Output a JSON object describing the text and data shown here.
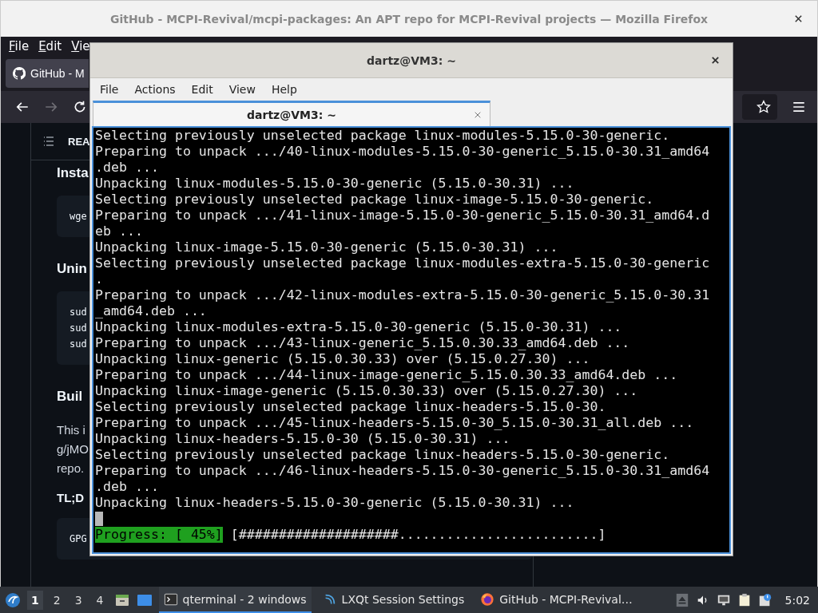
{
  "browser": {
    "title": "GitHub - MCPI-Revival/mcpi-packages: An APT repo for MCPI-Revival projects — Mozilla Firefox",
    "menu": [
      "File",
      "Edit",
      "Vie"
    ],
    "tabs": [
      {
        "label": "GitHub - M",
        "selected": true
      }
    ],
    "readme_label": "REA",
    "content": [
      {
        "kind": "heading",
        "text": "Insta"
      },
      {
        "kind": "code",
        "lines": [
          "wge"
        ]
      },
      {
        "kind": "heading",
        "text": "Unin"
      },
      {
        "kind": "code",
        "lines": [
          "sud",
          "sud",
          "sud"
        ]
      },
      {
        "kind": "heading",
        "text": "Buil"
      },
      {
        "kind": "paragraph",
        "lines": [
          "This i",
          "g/jMO",
          "repo."
        ]
      },
      {
        "kind": "subheading",
        "text": "TL;D"
      },
      {
        "kind": "code",
        "lines": [
          "GPG"
        ]
      }
    ]
  },
  "terminal": {
    "title": "dartz@VM3: ~",
    "menu": [
      "File",
      "Actions",
      "Edit",
      "View",
      "Help"
    ],
    "tabs": [
      {
        "label": "dartz@VM3: ~",
        "selected": true
      }
    ],
    "lines": [
      "Selecting previously unselected package linux-modules-5.15.0-30-generic.",
      "Preparing to unpack .../40-linux-modules-5.15.0-30-generic_5.15.0-30.31_amd64",
      ".deb ...",
      "Unpacking linux-modules-5.15.0-30-generic (5.15.0-30.31) ...",
      "Selecting previously unselected package linux-image-5.15.0-30-generic.",
      "Preparing to unpack .../41-linux-image-5.15.0-30-generic_5.15.0-30.31_amd64.d",
      "eb ...",
      "Unpacking linux-image-5.15.0-30-generic (5.15.0-30.31) ...",
      "Selecting previously unselected package linux-modules-extra-5.15.0-30-generic",
      ".",
      "Preparing to unpack .../42-linux-modules-extra-5.15.0-30-generic_5.15.0-30.31",
      "_amd64.deb ...",
      "Unpacking linux-modules-extra-5.15.0-30-generic (5.15.0-30.31) ...",
      "Preparing to unpack .../43-linux-generic_5.15.0.30.33_amd64.deb ...",
      "Unpacking linux-generic (5.15.0.30.33) over (5.15.0.27.30) ...",
      "Preparing to unpack .../44-linux-image-generic_5.15.0.30.33_amd64.deb ...",
      "Unpacking linux-image-generic (5.15.0.30.33) over (5.15.0.27.30) ...",
      "Selecting previously unselected package linux-headers-5.15.0-30.",
      "Preparing to unpack .../45-linux-headers-5.15.0-30_5.15.0-30.31_all.deb ...",
      "Unpacking linux-headers-5.15.0-30 (5.15.0-30.31) ...",
      "Selecting previously unselected package linux-headers-5.15.0-30-generic.",
      "Preparing to unpack .../46-linux-headers-5.15.0-30-generic_5.15.0-30.31_amd64",
      ".deb ...",
      "Unpacking linux-headers-5.15.0-30-generic (5.15.0-30.31) ..."
    ],
    "progress_label": "Progress: [ 45%]",
    "progress_bar": "[####################.........................]"
  },
  "taskbar": {
    "workspaces": [
      {
        "label": "1",
        "selected": true
      },
      {
        "label": "2",
        "selected": false
      },
      {
        "label": "3",
        "selected": false
      },
      {
        "label": "4",
        "selected": false
      }
    ],
    "tasks": [
      {
        "kind": "terminal",
        "label": "qterminal - 2 windows",
        "selected": true
      },
      {
        "kind": "settings",
        "label": "LXQt Session Settings",
        "selected": false
      },
      {
        "kind": "browser",
        "label": "GitHub - MCPI-Revival…",
        "selected": false
      }
    ],
    "clock": "5:02"
  }
}
